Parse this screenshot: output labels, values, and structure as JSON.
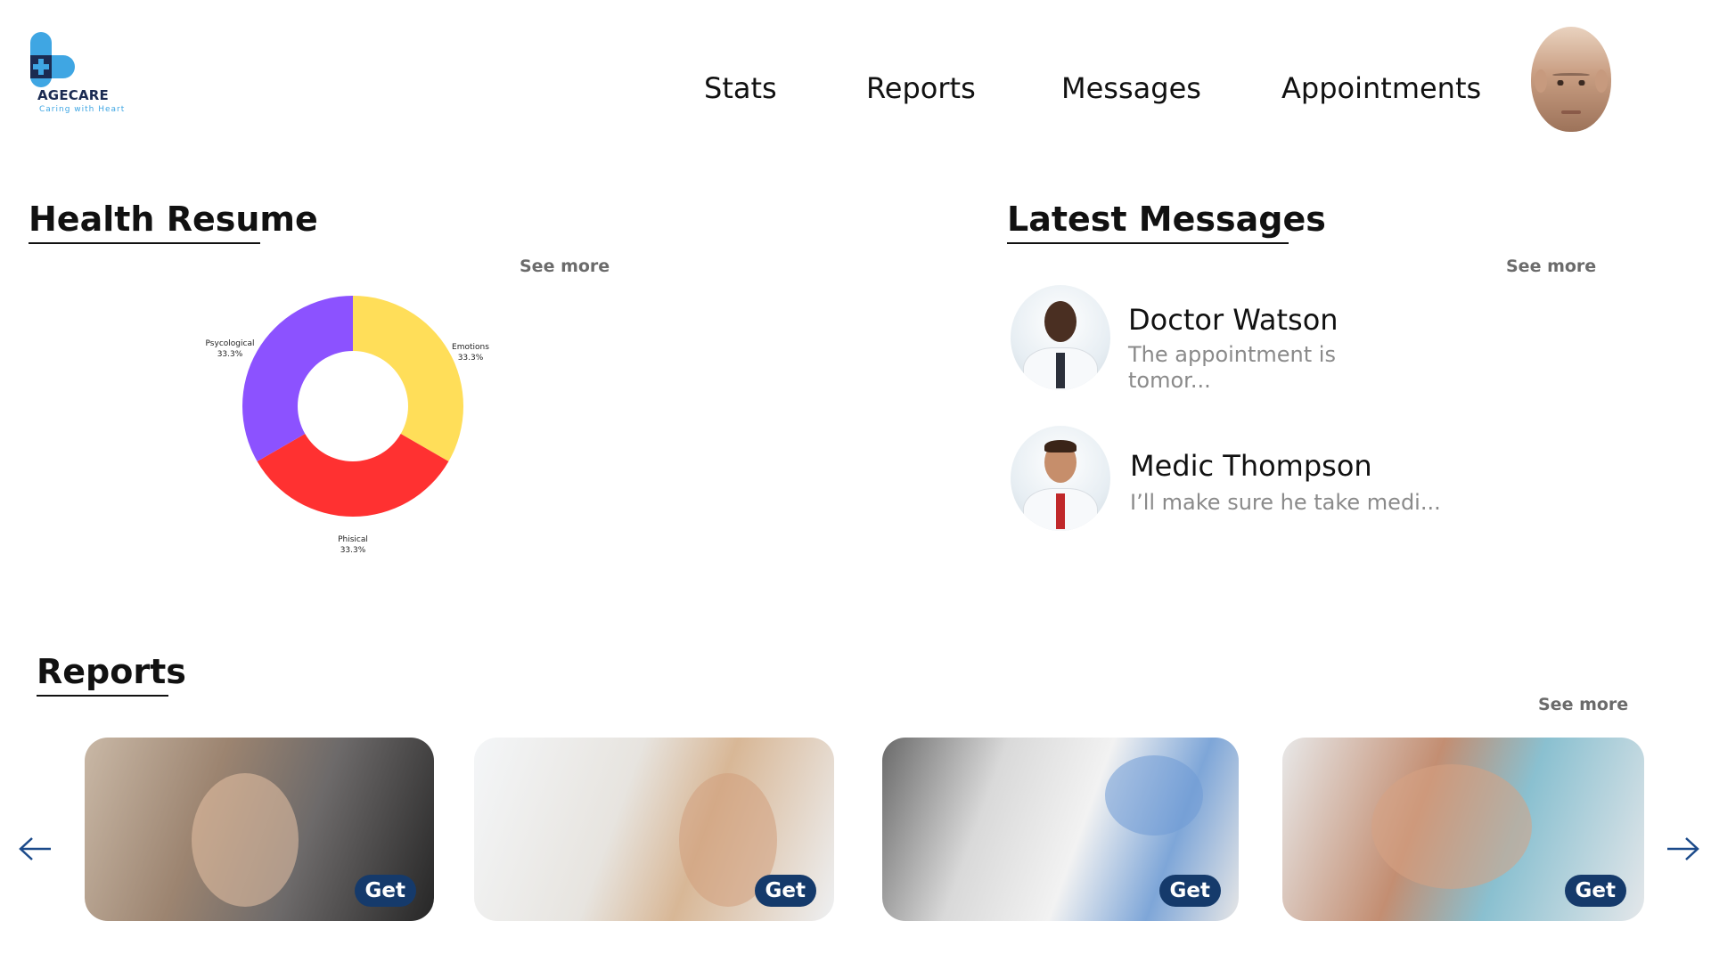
{
  "brand": {
    "name": "AGECARE",
    "tagline": "Caring with Heart",
    "colors": {
      "primary": "#1b2b52",
      "accent": "#3fa6e3",
      "button": "#153a6b"
    }
  },
  "nav": {
    "items": [
      {
        "label": "Stats"
      },
      {
        "label": "Reports"
      },
      {
        "label": "Messages"
      },
      {
        "label": "Appointments"
      }
    ]
  },
  "user": {
    "avatar_icon": "user-avatar"
  },
  "health_resume": {
    "title": "Health Resume",
    "see_more": "See more"
  },
  "chart_data": {
    "type": "pie",
    "title": "",
    "donut": true,
    "categories": [
      "Emotions",
      "Phisical",
      "Psycological"
    ],
    "values": [
      33.3,
      33.3,
      33.3
    ],
    "value_labels": [
      "33.3%",
      "33.3%",
      "33.3%"
    ],
    "colors": [
      "#ffde59",
      "#ff3131",
      "#8c52ff"
    ]
  },
  "latest_messages": {
    "title": "Latest Messages",
    "see_more": "See more",
    "items": [
      {
        "name": "Doctor Watson",
        "preview": "The appointment is tomor..."
      },
      {
        "name": "Medic Thompson",
        "preview": "I’ll make sure he take medi..."
      }
    ]
  },
  "reports": {
    "title": "Reports",
    "see_more": "See more",
    "cards": [
      {
        "button": "Get",
        "image": "eye-exam-photo"
      },
      {
        "button": "Get",
        "image": "stethoscope-checkup-photo"
      },
      {
        "button": "Get",
        "image": "therapy-session-photo"
      },
      {
        "button": "Get",
        "image": "dental-exam-photo"
      }
    ],
    "prev_icon": "arrow-left-icon",
    "next_icon": "arrow-right-icon"
  }
}
